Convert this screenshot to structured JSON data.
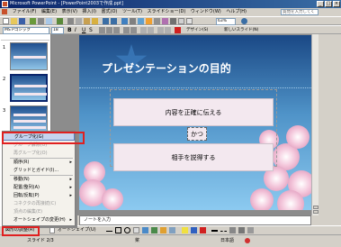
{
  "window": {
    "title": "Microsoft PowerPoint - [PowerPoint2003で作成.ppt]"
  },
  "menubar": {
    "items": [
      "ファイル(F)",
      "編集(E)",
      "表示(V)",
      "挿入(I)",
      "書式(O)",
      "ツール(T)",
      "スライドショー(D)",
      "ウィンドウ(W)",
      "ヘルプ(H)"
    ],
    "help_placeholder": "質問を入力してください"
  },
  "toolbar": {
    "zoom": "63%",
    "font_name": "MS Pゴシック",
    "font_size": "18",
    "design_label": "デザイン(S)",
    "new_slide_label": "新しいスライド(N)"
  },
  "slides_pane": {
    "thumb_numbers": [
      "1",
      "2",
      "3"
    ]
  },
  "slide": {
    "title": "プレゼンテーションの目的",
    "box1": "内容を正確に伝える",
    "connector": "かつ",
    "box2": "相手を説得する"
  },
  "notes": {
    "placeholder": "ノートを入力"
  },
  "context_menu": {
    "items": [
      {
        "label": "グループ化(G)",
        "disabled": false,
        "submenu": false
      },
      {
        "label": "グループ解除(U)",
        "disabled": true,
        "submenu": false
      },
      {
        "label": "再グループ化(O)",
        "disabled": true,
        "submenu": false
      },
      {
        "label": "順序(R)",
        "disabled": false,
        "submenu": true
      },
      {
        "label": "グリッドとガイド(I)...",
        "disabled": false,
        "submenu": false
      },
      {
        "label": "移動(N)",
        "disabled": false,
        "submenu": true
      },
      {
        "label": "配置/整列(A)",
        "disabled": false,
        "submenu": true
      },
      {
        "label": "回転/反転(P)",
        "disabled": false,
        "submenu": true
      },
      {
        "label": "コネクタの再接続(C)",
        "disabled": true,
        "submenu": false
      },
      {
        "label": "頂点の編集(E)",
        "disabled": true,
        "submenu": false
      },
      {
        "label": "オートシェイプの変更(H)",
        "disabled": false,
        "submenu": true
      },
      {
        "label": "既定の図形に設定(D)",
        "disabled": true,
        "submenu": false
      }
    ]
  },
  "drawbar": {
    "draw_button": "図形の調整(R)",
    "autoshape_button": "オートシェイプ(U)"
  },
  "status": {
    "slide_info": "スライド 2/3",
    "design": "桨",
    "language": "日本語"
  },
  "colors": {
    "highlight": "#e02020",
    "slide_top": "#1a4885",
    "banner": "#f3e8ef"
  }
}
